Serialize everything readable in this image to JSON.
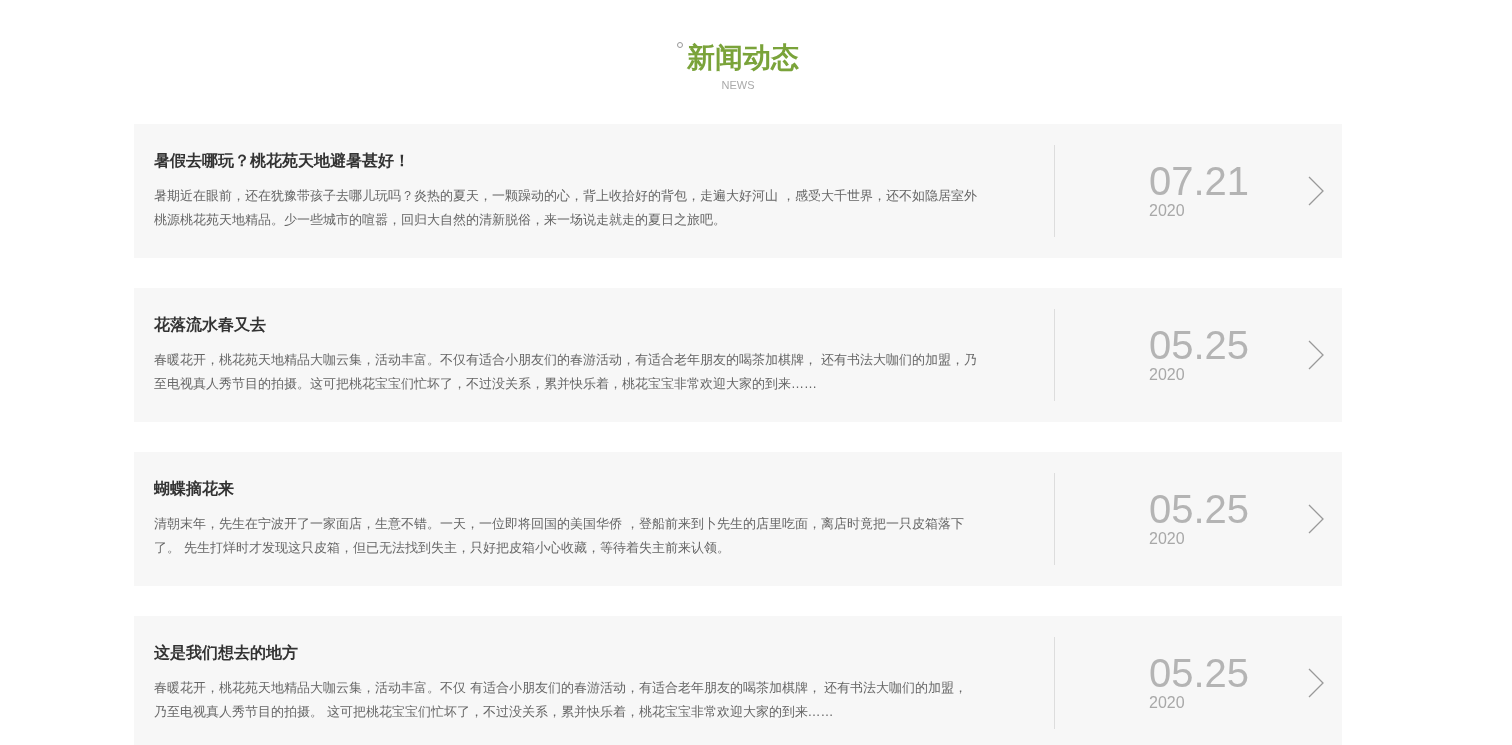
{
  "heading": {
    "title": "新闻动态",
    "subtitle": "NEWS"
  },
  "news": [
    {
      "title": "暑假去哪玩？桃花苑天地避暑甚好！",
      "summary": "暑期近在眼前，还在犹豫带孩子去哪儿玩吗？炎热的夏天，一颗躁动的心，背上收拾好的背包，走遍大好河山 ，感受大千世界，还不如隐居室外桃源桃花苑天地精品。少一些城市的喧嚣，回归大自然的清新脱俗，来一场说走就走的夏日之旅吧。",
      "date": "07.21",
      "year": "2020"
    },
    {
      "title": "花落流水春又去",
      "summary": "春暖花开，桃花苑天地精品大咖云集，活动丰富。不仅有适合小朋友们的春游活动，有适合老年朋友的喝茶加棋牌， 还有书法大咖们的加盟，乃至电视真人秀节目的拍摄。这可把桃花宝宝们忙坏了，不过没关系，累并快乐着，桃花宝宝非常欢迎大家的到来……",
      "date": "05.25",
      "year": "2020"
    },
    {
      "title": "蝴蝶摘花来",
      "summary": "清朝末年，先生在宁波开了一家面店，生意不错。一天，一位即将回国的美国华侨 ，登船前来到卜先生的店里吃面，离店时竟把一只皮箱落下了。 先生打烊时才发现这只皮箱，但已无法找到失主，只好把皮箱小心收藏，等待着失主前来认领。",
      "date": "05.25",
      "year": "2020"
    },
    {
      "title": "这是我们想去的地方",
      "summary": "春暖花开，桃花苑天地精品大咖云集，活动丰富。不仅 有适合小朋友们的春游活动，有适合老年朋友的喝茶加棋牌， 还有书法大咖们的加盟，乃至电视真人秀节目的拍摄。 这可把桃花宝宝们忙坏了，不过没关系，累并快乐着，桃花宝宝非常欢迎大家的到来……",
      "date": "05.25",
      "year": "2020"
    }
  ]
}
